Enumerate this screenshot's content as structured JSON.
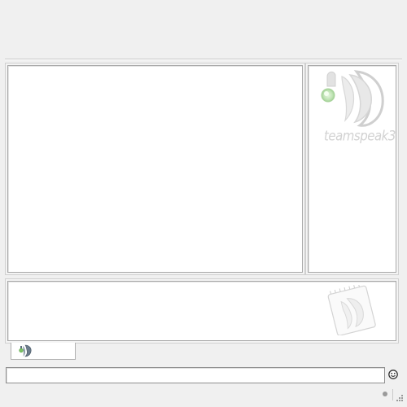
{
  "app": {
    "window_title": "TeamSpeak 3",
    "logo_text": "teamspeak3"
  },
  "chat": {
    "tab_icon": "teamspeak-icon",
    "input_value": "",
    "input_placeholder": ""
  },
  "toolbar": {
    "emoticon_icon": "emoticon-icon"
  },
  "status": {
    "indicator_icon": "status-dot-icon"
  },
  "colors": {
    "background": "#f0f0f0",
    "panel": "#ffffff",
    "border": "#a8a8a8",
    "logo_gray": "#d2d2d2",
    "logo_green": "#c8e8c0"
  }
}
